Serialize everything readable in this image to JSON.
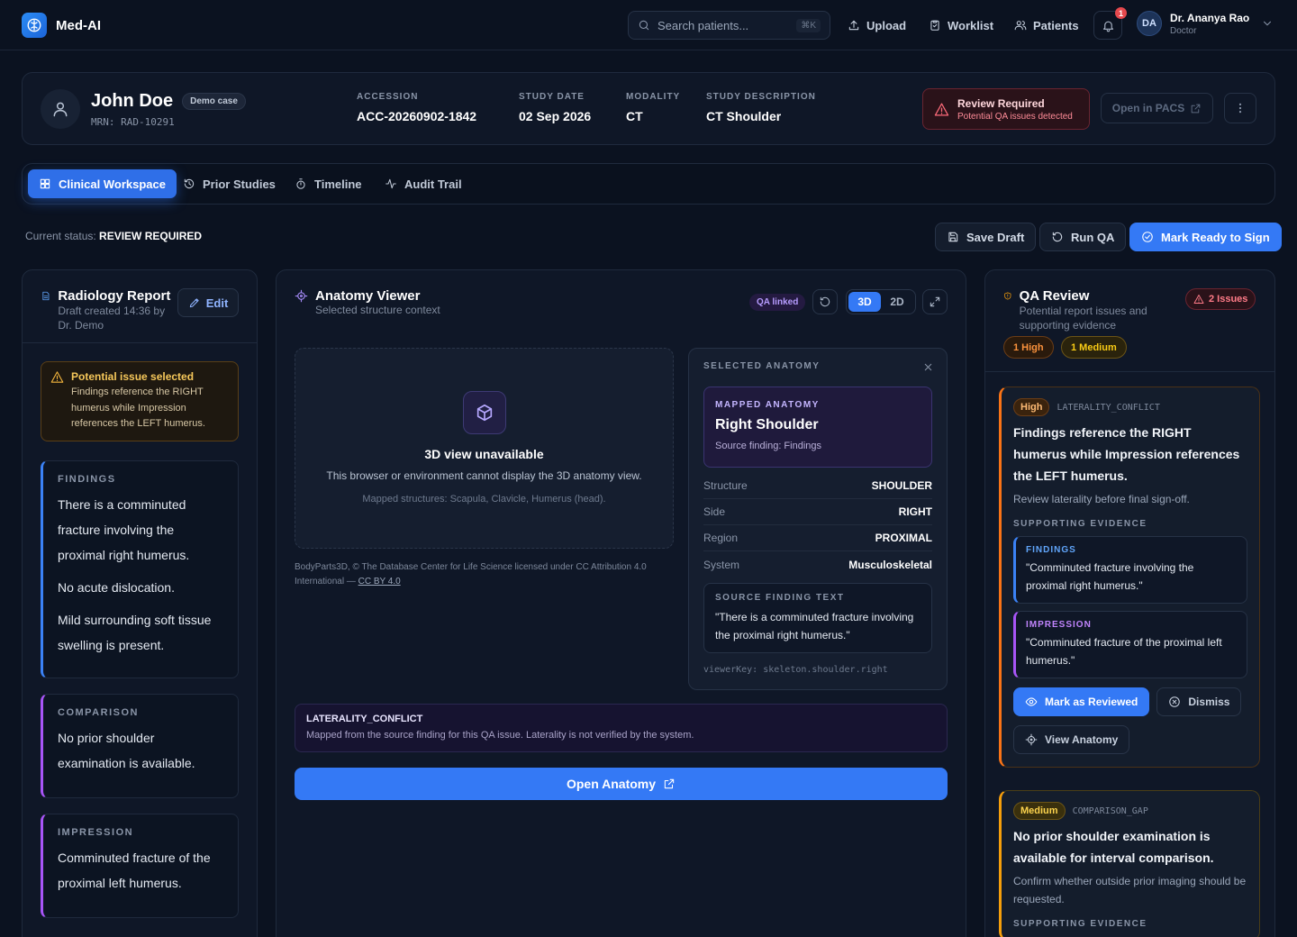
{
  "app": {
    "name": "Med-AI"
  },
  "nav": {
    "search_placeholder": "Search patients...",
    "search_shortcut": "⌘K",
    "upload": "Upload",
    "worklist": "Worklist",
    "patients": "Patients",
    "notifications_count": "1",
    "user": {
      "initials": "DA",
      "name": "Dr. Ananya Rao",
      "role": "Doctor"
    }
  },
  "patient": {
    "name": "John Doe",
    "badge": "Demo case",
    "mrn": "MRN: RAD-10291",
    "accession_label": "ACCESSION",
    "accession": "ACC-20260902-1842",
    "study_date_label": "STUDY DATE",
    "study_date": "02 Sep 2026",
    "modality_label": "MODALITY",
    "modality": "CT",
    "description_label": "STUDY DESCRIPTION",
    "description": "CT Shoulder",
    "review_title": "Review Required",
    "review_sub": "Potential QA issues detected",
    "pacs_button": "Open in PACS"
  },
  "tabs": [
    {
      "label": "Clinical Workspace"
    },
    {
      "label": "Prior Studies"
    },
    {
      "label": "Timeline"
    },
    {
      "label": "Audit Trail"
    }
  ],
  "status": {
    "label": "Current status:",
    "value": "REVIEW REQUIRED",
    "save_draft": "Save Draft",
    "run_qa": "Run QA",
    "mark_ready": "Mark Ready to Sign"
  },
  "report": {
    "title": "Radiology Report",
    "subtitle": "Draft created 14:36 by Dr. Demo",
    "edit": "Edit",
    "issue_title": "Potential issue selected",
    "issue_text": "Findings reference the RIGHT humerus while Impression references the LEFT humerus.",
    "findings_label": "FINDINGS",
    "findings": [
      "There is a comminuted fracture involving the proximal right humerus.",
      "No acute dislocation.",
      "Mild surrounding soft tissue swelling is present."
    ],
    "comparison_label": "COMPARISON",
    "comparison": "No prior shoulder examination is available.",
    "impression_label": "IMPRESSION",
    "impression": "Comminuted fracture of the proximal left humerus."
  },
  "viewer": {
    "title": "Anatomy Viewer",
    "subtitle": "Selected structure context",
    "qa_linked": "QA linked",
    "mode_3d": "3D",
    "mode_2d": "2D",
    "unavailable_title": "3D view unavailable",
    "unavailable_text": "This browser or environment cannot display the 3D anatomy view.",
    "mapped_structures": "Mapped structures: Scapula, Clavicle, Humerus (head).",
    "attribution": "BodyParts3D, © The Database Center for Life Science licensed under CC Attribution 4.0 International —",
    "license": "CC BY 4.0",
    "selected_label": "SELECTED ANATOMY",
    "mapped_label": "MAPPED ANATOMY",
    "mapped_name": "Right Shoulder",
    "mapped_source": "Source finding: Findings",
    "props": [
      {
        "key": "Structure",
        "value": "SHOULDER"
      },
      {
        "key": "Side",
        "value": "RIGHT"
      },
      {
        "key": "Region",
        "value": "PROXIMAL"
      },
      {
        "key": "System",
        "value": "Musculoskeletal"
      }
    ],
    "source_label": "SOURCE FINDING TEXT",
    "source_text": "\"There is a comminuted fracture involving the proximal right humerus.\"",
    "viewer_key": "viewerKey: skeleton.shoulder.right",
    "note_title": "LATERALITY_CONFLICT",
    "note_text": "Mapped from the source finding for this QA issue. Laterality is not verified by the system.",
    "open_button": "Open Anatomy"
  },
  "qa": {
    "title": "QA Review",
    "subtitle": "Potential report issues and supporting evidence",
    "issues_count": "2 Issues",
    "high_count": "1 High",
    "medium_count": "1 Medium",
    "issue1": {
      "severity": "High",
      "code": "LATERALITY_CONFLICT",
      "title": "Findings reference the RIGHT humerus while Impression references the LEFT humerus.",
      "desc": "Review laterality before final sign-off.",
      "evidence_label": "SUPPORTING EVIDENCE",
      "ev1_label": "FINDINGS",
      "ev1_text": "\"Comminuted fracture involving the proximal right humerus.\"",
      "ev2_label": "IMPRESSION",
      "ev2_text": "\"Comminuted fracture of the proximal left humerus.\"",
      "mark_reviewed": "Mark as Reviewed",
      "dismiss": "Dismiss",
      "view_anatomy": "View Anatomy"
    },
    "issue2": {
      "severity": "Medium",
      "code": "COMPARISON_GAP",
      "title": "No prior shoulder examination is available for interval comparison.",
      "desc": "Confirm whether outside prior imaging should be requested.",
      "evidence_label": "SUPPORTING EVIDENCE"
    }
  }
}
